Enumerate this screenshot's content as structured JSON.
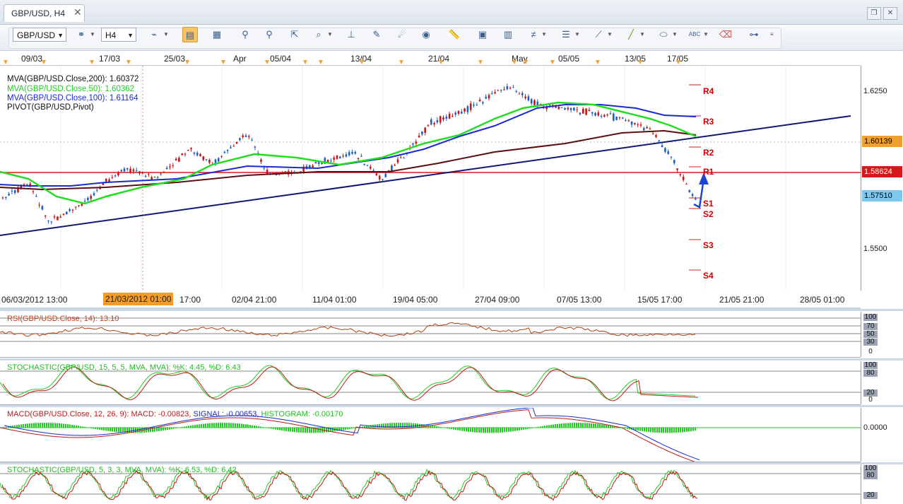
{
  "tab": {
    "title": "GBP/USD, H4",
    "close": "✕"
  },
  "window_buttons": [
    "❐",
    "✕"
  ],
  "toolbar": {
    "symbol": "GBP/USD",
    "timeframe": "H4",
    "icons": [
      "zoom-fit-icon",
      "timeframe-icon",
      "chart-type-icon",
      "bar-chart-icon",
      "candle-chart-icon",
      "crosshair-icon",
      "zoom-in-icon",
      "zoom-out-icon",
      "autoscroll-icon",
      "chart-shift-icon",
      "indicators-icon",
      "templates-icon",
      "refresh-icon",
      "globe-icon",
      "ruler-icon",
      "picture-icon",
      "save-icon",
      "fibonacci-icon",
      "channel-icon",
      "pitchfork-icon",
      "trendline-icon",
      "ellipse-icon",
      "text-icon",
      "eraser-icon",
      "hierarchy-icon"
    ]
  },
  "top_axis": {
    "labels": [
      "09/03",
      "17/03",
      "25/03",
      "Apr",
      "05/04",
      "13/04",
      "21/04",
      "May",
      "05/05",
      "13/05",
      "17/05"
    ]
  },
  "bottom_axis": {
    "labels": [
      "06/03/2012 13:00",
      "21/03/2012 01:00",
      "17:00",
      "02/04 21:00",
      "11/04 01:00",
      "19/04 05:00",
      "27/04 09:00",
      "07/05 13:00",
      "15/05 17:00",
      "21/05 21:00",
      "28/05 01:00"
    ],
    "highlight": "21/03/2012 01:00"
  },
  "price_axis": {
    "ticks": [
      "1.6250",
      "1.5500"
    ],
    "labels": [
      {
        "text": "1.60139",
        "bg": "#f0a030",
        "fg": "#000000"
      },
      {
        "text": "1.58624",
        "bg": "#d81818",
        "fg": "#ffffff"
      },
      {
        "text": "1.57510",
        "bg": "#7ec8f0",
        "fg": "#000000"
      }
    ]
  },
  "legend": {
    "ma200": "MVA(GBP/USD.Close,200): 1.60372",
    "ma50": "MVA(GBP/USD.Close,50): 1.60362",
    "ma100": "MVA(GBP/USD.Close,100): 1.61164",
    "pivot": "PIVOT(GBP/USD,Pivot)"
  },
  "pivots": [
    "R4",
    "R3",
    "R2",
    "R1",
    "S1",
    "S2",
    "S3",
    "S4"
  ],
  "indicators": {
    "rsi": {
      "label": "RSI(GBP/USD.Close, 14): 13.10",
      "levels": [
        "100",
        "70",
        "50",
        "30",
        "0"
      ]
    },
    "stoch1": {
      "label": "STOCHASTIC(GBP/USD, 15, 5, 5, MVA, MVA): %K: 4.45, %D: 6.43",
      "levels": [
        "100",
        "80",
        "20",
        "0"
      ]
    },
    "macd": {
      "title": "MACD(GBP/USD.Close, 12, 26, 9):",
      "macd": "MACD: -0.00823",
      "signal": "SIGNAL: -0.00653",
      "histogram": "HISTOGRAM: -0.00170",
      "levels": [
        "0.0000"
      ]
    },
    "stoch2": {
      "label": "STOCHASTIC(GBP/USD, 5, 3, 3, MVA, MVA): %K: 6.53, %D: 6.42",
      "levels": [
        "100",
        "80",
        "20"
      ]
    }
  },
  "colors": {
    "ma200": "#5a1010",
    "ma50": "#22dd22",
    "ma100": "#1a2ad0",
    "trendline": "#101870",
    "hline": "#d81818",
    "pivot_text": "#cc0000",
    "bull": "#2060c0",
    "bear": "#c01818",
    "arrow": "#1a44d8"
  }
}
